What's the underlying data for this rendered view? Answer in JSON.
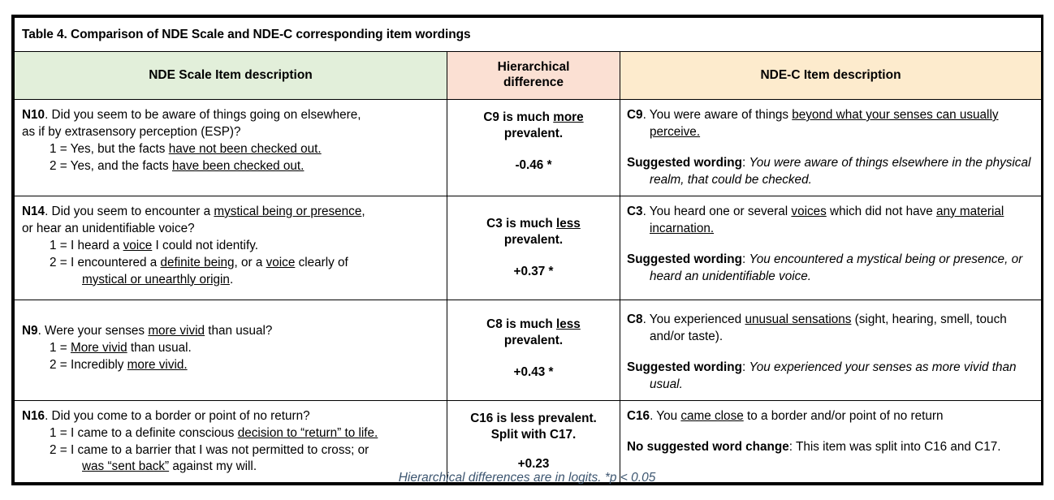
{
  "table": {
    "title": "Table 4. Comparison of NDE Scale and NDE-C corresponding item wordings",
    "headers": {
      "left": "NDE Scale Item description",
      "middle_line1": "Hierarchical",
      "middle_line2": "difference",
      "right": "NDE-C Item description"
    },
    "colors": {
      "header_left_bg": "#E2EFDA",
      "header_middle_bg": "#FBE0D3",
      "header_right_bg": "#FDEBCD",
      "footnote_text": "#3E5771",
      "border": "#000000"
    },
    "rows": [
      {
        "nde_item_code": "N10",
        "nde_stem_part1": ". Did you seem to be aware of things going on elsewhere,",
        "nde_stem_part2": "as if by extrasensory perception (ESP)?",
        "nde_option1_prefix": "1 = Yes, but the facts ",
        "nde_option1_underlined": "have not been checked out.",
        "nde_option2_prefix": "2 = Yes, and the facts ",
        "nde_option2_underlined": "have been checked out.",
        "diff_line1_prefix": "C9 is much ",
        "diff_line1_underlined": "more",
        "diff_line2": "prevalent.",
        "diff_value": "-0.46 *",
        "ndec_item_code": "C9",
        "ndec_text_part1": ". You were aware of things ",
        "ndec_underlined": "beyond what your senses can usually perceive.",
        "suggested_label": "Suggested wording",
        "suggested_text": "You were aware of things elsewhere in the physical realm, that could be checked."
      },
      {
        "nde_item_code": "N14",
        "nde_stem_part1": ". Did you seem to encounter a ",
        "nde_stem_underlined": "mystical being or presence",
        "nde_stem_part1b": ",",
        "nde_stem_part2": "or hear an unidentifiable voice?",
        "nde_option1_prefix": "1 = I heard a ",
        "nde_option1_underlined": "voice",
        "nde_option1_suffix": " I could not identify.",
        "nde_option2_prefix": "2 = I encountered a ",
        "nde_option2_underlined1": "definite being",
        "nde_option2_mid": ", or a ",
        "nde_option2_underlined2": "voice",
        "nde_option2_suffix": " clearly of ",
        "nde_option2_underlined3": "mystical or unearthly origin",
        "nde_option2_end": ".",
        "diff_line1_prefix": "C3 is much ",
        "diff_line1_underlined": "less",
        "diff_line2": "prevalent.",
        "diff_value": "+0.37 *",
        "ndec_item_code": "C3",
        "ndec_text_part1": ". You heard one or several ",
        "ndec_underlined1": "voices",
        "ndec_text_part2": " which did not have ",
        "ndec_underlined2": "any material incarnation.",
        "suggested_label": "Suggested wording",
        "suggested_text": "You encountered a mystical being or presence, or heard an unidentifiable voice."
      },
      {
        "nde_item_code": "N9",
        "nde_stem_part1": ". Were your senses ",
        "nde_stem_underlined": "more vivid",
        "nde_stem_part2": " than usual?",
        "nde_option1_prefix": "1 = ",
        "nde_option1_underlined": "More vivid",
        "nde_option1_suffix": " than usual.",
        "nde_option2_prefix": "2 = Incredibly ",
        "nde_option2_underlined": "more vivid.",
        "diff_line1_prefix": "C8 is much ",
        "diff_line1_underlined": "less",
        "diff_line2": "prevalent.",
        "diff_value": "+0.43 *",
        "ndec_item_code": "C8",
        "ndec_text_part1": ". You experienced ",
        "ndec_underlined1": "unusual sensations",
        "ndec_text_part2": " (sight, hearing, smell, touch and/or taste).",
        "suggested_label": "Suggested wording",
        "suggested_text": "You experienced your senses as more vivid than usual."
      },
      {
        "nde_item_code": "N16",
        "nde_stem_part1": ". Did you come to a border or point of no return?",
        "nde_option1_prefix": "1 = I came to a definite conscious ",
        "nde_option1_underlined": "decision to “return” to life.",
        "nde_option2_prefix": "2 = I came to a barrier that I was not permitted to cross; or ",
        "nde_option2_underlined": "was “sent back”",
        "nde_option2_suffix": " against my will.",
        "diff_line1": "C16 is less prevalent.",
        "diff_line2": "Split with C17.",
        "diff_value": "+0.23",
        "ndec_item_code": "C16",
        "ndec_text_part1": ". You ",
        "ndec_underlined1": "came close",
        "ndec_text_part2": " to a border and/or point of no return",
        "suggested_label": "No suggested word change",
        "suggested_text": "This item was split into C16 and C17."
      }
    ]
  },
  "footnote": "Hierarchical differences are in logits. *p < 0.05"
}
